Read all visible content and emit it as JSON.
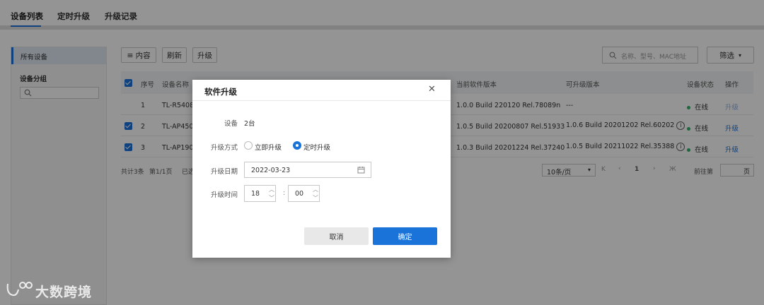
{
  "tabs": [
    {
      "label": "设备列表",
      "active": true
    },
    {
      "label": "定时升级",
      "active": false
    },
    {
      "label": "升级记录",
      "active": false
    }
  ],
  "sidebar": {
    "all_devices": "所有设备",
    "group_title": "设备分组",
    "group_search_placeholder": ""
  },
  "toolbar": {
    "content_label": "内容",
    "refresh_label": "刷新",
    "upgrade_label": "升级",
    "search_placeholder": "名称、型号、MAC地址",
    "filter_label": "筛选"
  },
  "table": {
    "headers": [
      "序号",
      "设备名称",
      "当前软件版本",
      "可升级版本",
      "设备状态",
      "操作"
    ],
    "rows": [
      {
        "index": "1",
        "name": "TL-R5408",
        "current": "1.0.0 Build 220120 Rel.78089n",
        "available": "---",
        "status": "在线",
        "action": "升级",
        "checked": false
      },
      {
        "index": "2",
        "name": "TL-AP450",
        "current": "1.0.5 Build 20200807 Rel.51933",
        "available": "1.0.6 Build 20201202 Rel.60202",
        "status": "在线",
        "action": "升级",
        "checked": true
      },
      {
        "index": "3",
        "name": "TL-AP190",
        "current": "1.0.3 Build 20201224 Rel.37240",
        "available": "1.0.5 Build 20211022 Rel.35388",
        "status": "在线",
        "action": "升级",
        "checked": true
      }
    ]
  },
  "footer": {
    "summary": "共计3条",
    "page_info": "第1/1页",
    "selected_prefix": "已选",
    "page_size": "10条/页",
    "current_page": "1",
    "goto_label": "前往第",
    "page_unit": "页"
  },
  "dialog": {
    "title": "软件升级",
    "device_label": "设备",
    "device_value": "2台",
    "mode_label": "升级方式",
    "mode_now": "立即升级",
    "mode_scheduled": "定时升级",
    "mode_selected": "定时升级",
    "date_label": "升级日期",
    "date_value": "2022-03-23",
    "time_label": "升级时间",
    "hour": "18",
    "minute": "00",
    "cancel_label": "取消",
    "ok_label": "确定"
  },
  "watermark": "大数跨境",
  "colors": {
    "accent": "#1a73d9",
    "online": "#2bb36b"
  }
}
